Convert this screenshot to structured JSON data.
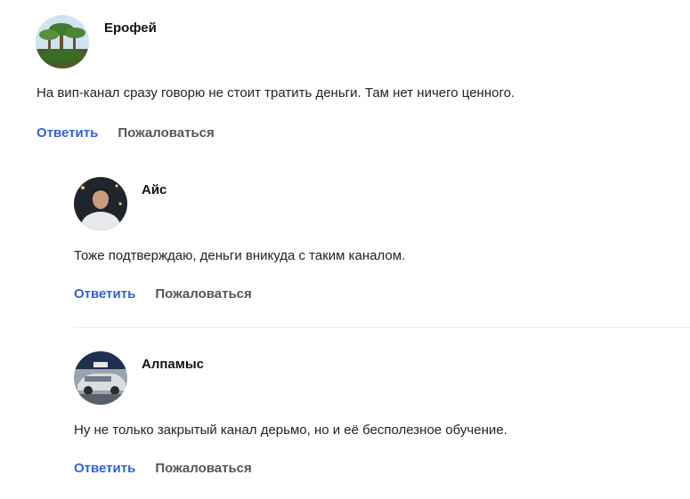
{
  "comments": [
    {
      "author": "Ерофей",
      "avatar_icon": "palm-trees-avatar",
      "text": "На вип-канал сразу говорю не стоит тратить деньги. Там нет ничего ценного.",
      "reply_label": "Ответить",
      "report_label": "Пожаловаться"
    },
    {
      "author": "Айс",
      "avatar_icon": "man-portrait-avatar",
      "text": "Тоже подтверждаю, деньги вникуда с таким каналом.",
      "reply_label": "Ответить",
      "report_label": "Пожаловаться"
    },
    {
      "author": "Алпамыс",
      "avatar_icon": "car-avatar",
      "text": "Ну не только закрытый канал дерьмо, но и её бесполезное обучение.",
      "reply_label": "Ответить",
      "report_label": "Пожаловаться"
    }
  ],
  "colors": {
    "link": "#2f62d9",
    "muted": "#555555",
    "divider": "#e6e8ee"
  }
}
